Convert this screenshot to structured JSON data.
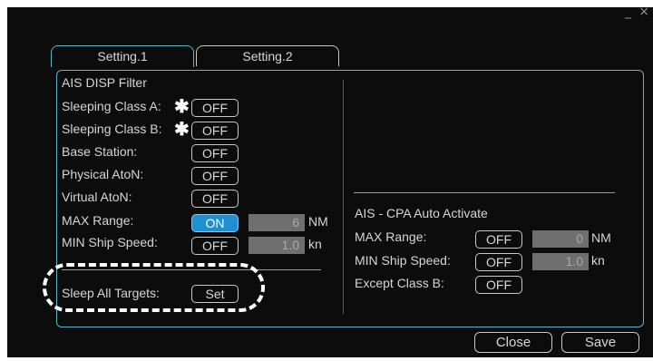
{
  "window": {
    "controls": "_ ×"
  },
  "tabs": [
    {
      "label": "Setting.1",
      "active": true
    },
    {
      "label": "Setting.2",
      "active": false
    }
  ],
  "left": {
    "section_title": "AIS DISP Filter",
    "rows": [
      {
        "label": "Sleeping Class A:",
        "star": "✱",
        "button": "OFF"
      },
      {
        "label": "Sleeping Class B:",
        "star": "✱",
        "button": "OFF"
      },
      {
        "label": "Base Station:",
        "button": "OFF"
      },
      {
        "label": "Physical AtoN:",
        "button": "OFF"
      },
      {
        "label": "Virtual AtoN:",
        "button": "OFF"
      }
    ],
    "max_range": {
      "label": "MAX Range:",
      "button": "ON",
      "value": "6",
      "unit": "NM"
    },
    "min_speed": {
      "label": "MIN Ship Speed:",
      "button": "OFF",
      "value": "1.0",
      "unit": "kn"
    },
    "sleep_all": {
      "label": "Sleep All Targets:",
      "button": "Set"
    }
  },
  "right": {
    "section_title": "AIS - CPA Auto Activate",
    "max_range": {
      "label": "MAX Range:",
      "button": "OFF",
      "value": "0",
      "unit": "NM"
    },
    "min_speed": {
      "label": "MIN Ship Speed:",
      "button": "OFF",
      "value": "1.0",
      "unit": "kn"
    },
    "except_b": {
      "label": "Except Class B:",
      "button": "OFF"
    }
  },
  "footer": {
    "close_label": "Close",
    "save_label": "Save"
  },
  "colors": {
    "background": "#0c0c0c",
    "accent": "#5fb3c9",
    "on_button": "#1f8fd0"
  }
}
